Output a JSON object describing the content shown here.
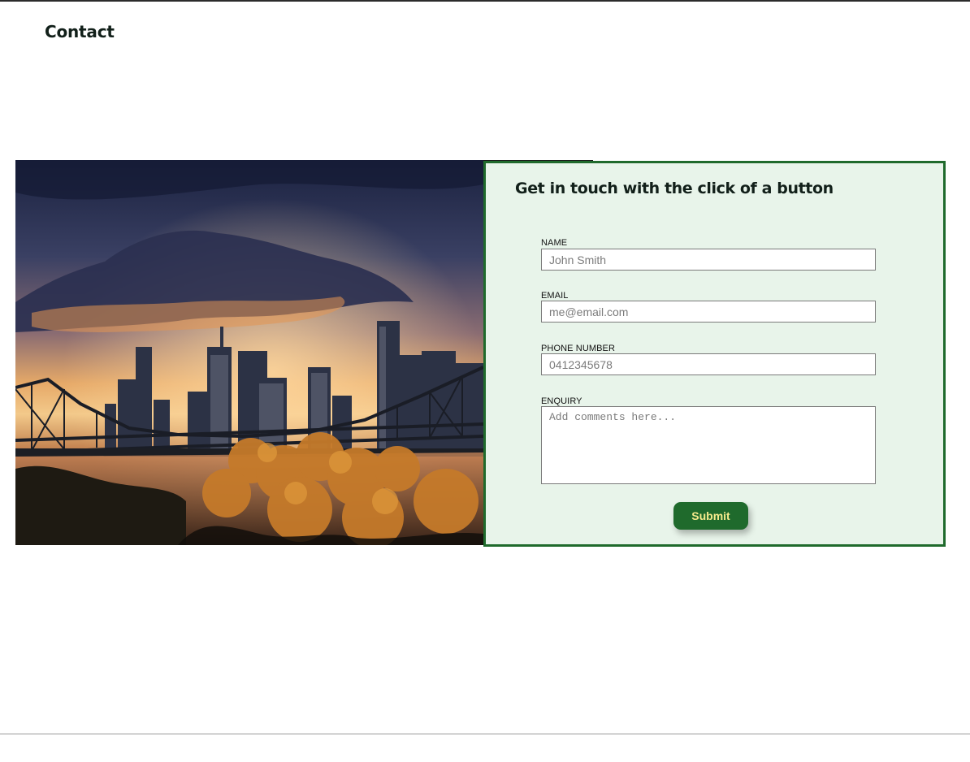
{
  "page": {
    "title": "Contact"
  },
  "hero_image": {
    "alt": "Brisbane city skyline with Story Bridge at sunset"
  },
  "contact_form": {
    "heading": "Get in touch with the click of a button",
    "name_label": "NAME",
    "name_placeholder": "John Smith",
    "email_label": "EMAIL",
    "email_placeholder": "me@email.com",
    "phone_label": "PHONE NUMBER",
    "phone_placeholder": "0412345678",
    "enquiry_label": "ENQUIRY",
    "enquiry_placeholder": "Add comments here...",
    "submit_label": "Submit"
  },
  "colors": {
    "panel_background": "#e8f4ea",
    "panel_border": "#1f6a2c",
    "button_background": "#1f6a2c",
    "button_text": "#f6ea8c"
  }
}
